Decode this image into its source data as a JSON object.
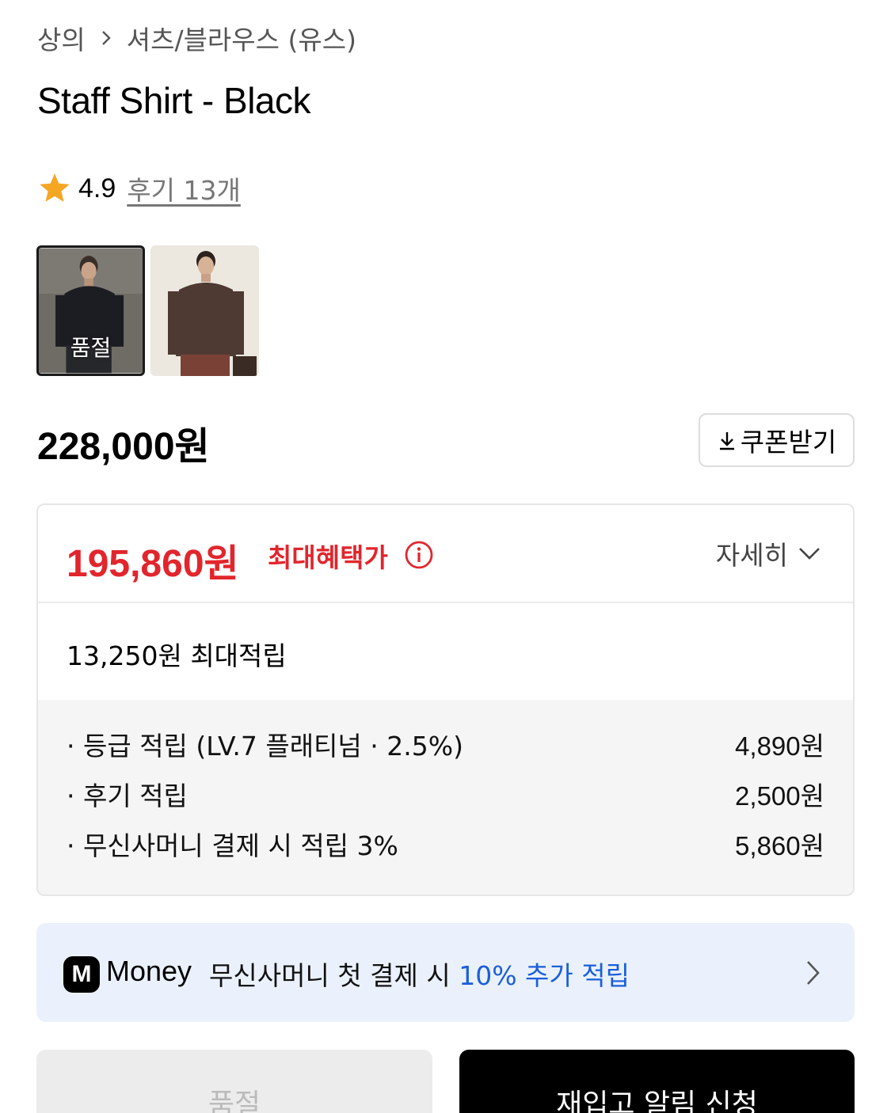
{
  "breadcrumb": {
    "items": [
      "상의",
      "셔츠/블라우스 (유스)"
    ]
  },
  "product": {
    "title": "Staff Shirt - Black",
    "rating": "4.9",
    "review_link": "후기 13개",
    "price": "228,000원"
  },
  "thumbnails": [
    {
      "label": "품절",
      "selected": true
    },
    {
      "label": "",
      "selected": false
    }
  ],
  "coupon": {
    "label": "쿠폰받기",
    "icon": "download-icon"
  },
  "benefit": {
    "sale_price": "195,860원",
    "sale_label": "최대혜택가",
    "detail_label": "자세히",
    "accum_total": "13,250원 최대적립",
    "items": [
      {
        "label": "· 등급 적립 (LV.7 플래티넘 · 2.5%)",
        "amount": "4,890원"
      },
      {
        "label": "· 후기 적립",
        "amount": "2,500원"
      },
      {
        "label": "· 무신사머니 결제 시 적립 3%",
        "amount": "5,860원"
      }
    ]
  },
  "money_banner": {
    "logo": "M",
    "brand": "Money",
    "text": "무신사머니 첫 결제 시 ",
    "highlight": "10% 추가 적립"
  },
  "buttons": {
    "soldout": "품절",
    "restock": "재입고 알림 신청"
  },
  "colors": {
    "accent_red": "#e2252c",
    "link_blue": "#1a5fd9",
    "banner_bg": "#ebf1fc",
    "star": "#f5a623"
  }
}
